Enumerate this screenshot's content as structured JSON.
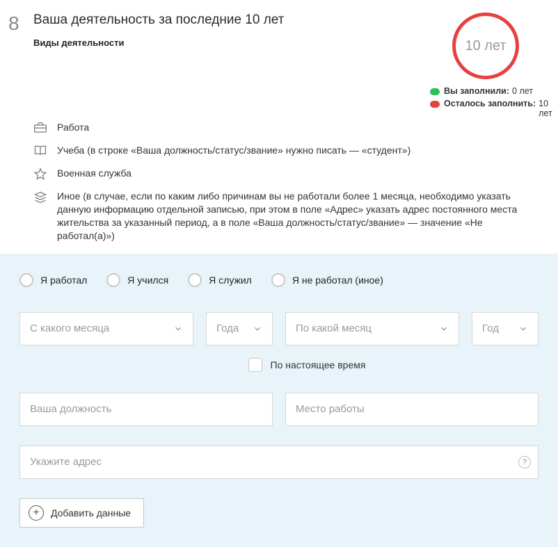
{
  "step_number": "8",
  "title": "Ваша деятельность за последние 10 лет",
  "subtitle": "Виды деятельности",
  "circle_text": "10 лет",
  "progress": {
    "filled_label": "Вы заполнили:",
    "filled_value": "0 лет",
    "remain_label": "Осталось заполнить:",
    "remain_value": "10 лет"
  },
  "activities": {
    "work": "Работа",
    "study": "Учеба (в строке «Ваша должность/статус/звание» нужно писать — «студент»)",
    "military": "Военная служба",
    "other": "Иное (в случае, если по каким либо причинам вы не работали более 1 месяца, необходимо указать данную информацию отдельной записью, при этом в поле «Адрес» указать адрес постоянного места жительства за указанный период, а в поле «Ваша должность/статус/звание» — значение «Не работал(а)»)"
  },
  "radios": {
    "worked": "Я работал",
    "studied": "Я учился",
    "served": "Я служил",
    "none": "Я не работал (иное)"
  },
  "form": {
    "month_from": "С какого месяца",
    "year_from": "Года",
    "month_to": "По какой месяц",
    "year_to": "Год",
    "present_label": "По настоящее время",
    "position": "Ваша должность",
    "workplace": "Место работы",
    "address": "Укажите адрес",
    "help": "?",
    "add_button": "Добавить данные"
  }
}
